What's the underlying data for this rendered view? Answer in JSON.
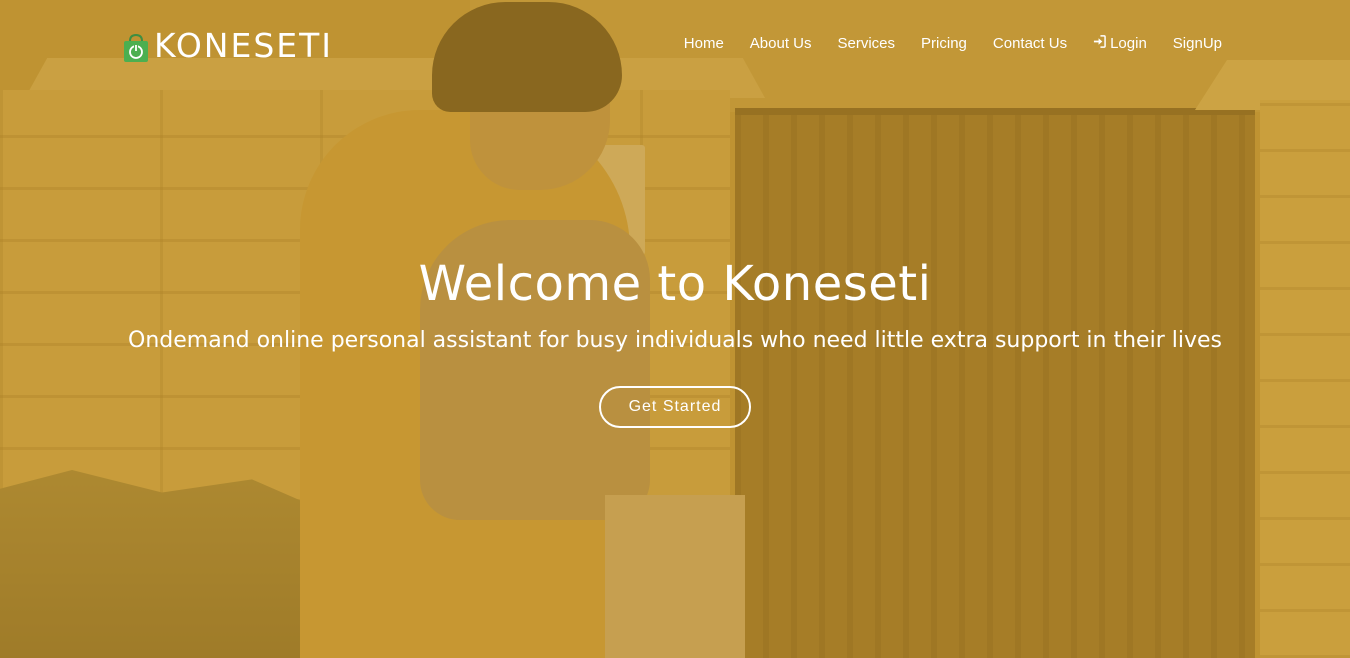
{
  "brand": {
    "name": "KONESETI",
    "logo_icon": "shopping-bag-power-icon",
    "logo_color": "#4caf50"
  },
  "nav": {
    "items": [
      {
        "label": "Home"
      },
      {
        "label": "About Us"
      },
      {
        "label": "Services"
      },
      {
        "label": "Pricing"
      },
      {
        "label": "Contact Us"
      },
      {
        "label": "Login",
        "icon": "sign-in-icon"
      },
      {
        "label": "SignUp"
      }
    ]
  },
  "hero": {
    "title": "Welcome to Koneseti",
    "subtitle": "Ondemand online personal assistant for busy individuals who need little extra support in their lives",
    "cta_label": "Get Started",
    "overlay_color": "#c79628"
  }
}
